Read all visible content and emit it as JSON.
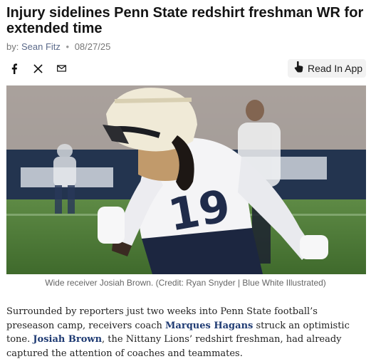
{
  "article": {
    "headline": "Injury sidelines Penn State redshirt freshman WR for extended time",
    "byline_prefix": "by:",
    "author": "Sean Fitz",
    "date": "08/27/25"
  },
  "share": {
    "icons": [
      "facebook-icon",
      "x-icon",
      "email-icon"
    ]
  },
  "read_in_app": {
    "label": "Read In App"
  },
  "hero_image": {
    "jersey_number": "19",
    "caption": "Wide receiver Josiah Brown. (Credit: Ryan Snyder | Blue White Illustrated)"
  },
  "body": {
    "p1_part1": "Surrounded by reporters just two weeks into Penn State football’s preseason camp, receivers coach ",
    "link1": "Marques Hagans",
    "p1_part2": " struck an optimistic tone. ",
    "link2": "Josiah Brown",
    "p1_part3": ", the Nittany Lions’ redshirt freshman, had already captured the attention of coaches and teammates."
  },
  "colors": {
    "link": "#1f3b73",
    "author": "#5b6a8a"
  }
}
